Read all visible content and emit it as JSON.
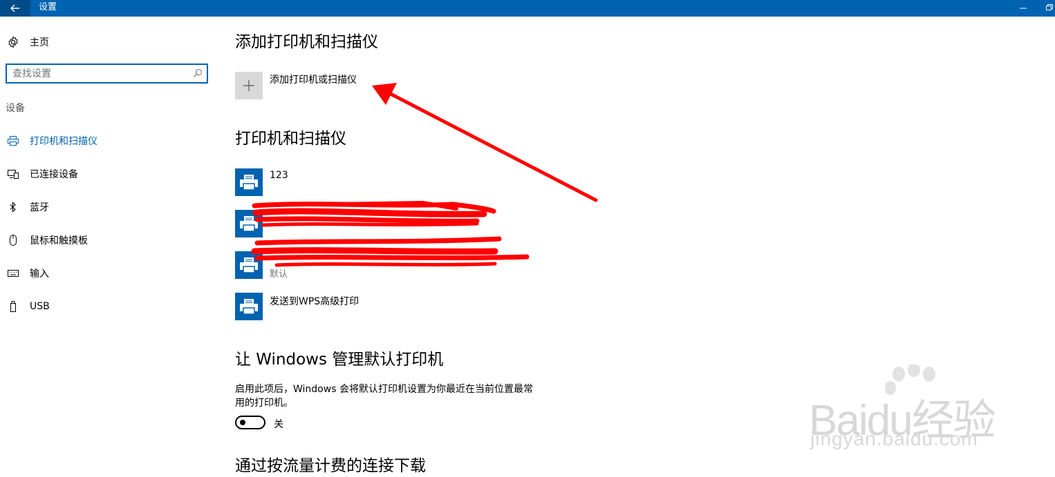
{
  "window": {
    "title": "设置"
  },
  "sidebar": {
    "home_label": "主页",
    "search_placeholder": "查找设置",
    "section_label": "设备",
    "items": [
      {
        "label": "打印机和扫描仪",
        "icon": "printer-icon",
        "active": true
      },
      {
        "label": "已连接设备",
        "icon": "connected-devices-icon",
        "active": false
      },
      {
        "label": "蓝牙",
        "icon": "bluetooth-icon",
        "active": false
      },
      {
        "label": "鼠标和触摸板",
        "icon": "mouse-icon",
        "active": false
      },
      {
        "label": "输入",
        "icon": "keyboard-icon",
        "active": false
      },
      {
        "label": "USB",
        "icon": "usb-icon",
        "active": false
      }
    ]
  },
  "main": {
    "add_section_title": "添加打印机和扫描仪",
    "add_button_label": "添加打印机或扫描仪",
    "printers_section_title": "打印机和扫描仪",
    "printers": [
      {
        "name": "123",
        "status": ""
      },
      {
        "name": "",
        "status": ""
      },
      {
        "name": "",
        "status": "默认"
      },
      {
        "name": "发送到WPS高级打印",
        "status": ""
      }
    ],
    "default_section_title": "让 Windows 管理默认打印机",
    "default_description": "启用此项后，Windows 会将默认打印机设置为你最近在当前位置最常用的打印机。",
    "default_toggle_label": "关",
    "default_toggle_on": false,
    "metered_section_title": "通过按流量计费的连接下载"
  },
  "watermark": {
    "logo_text": "Baidu经验",
    "url_text": "jingyan.baidu.com"
  },
  "colors": {
    "accent": "#0063b1",
    "annotation": "#ff0000"
  }
}
